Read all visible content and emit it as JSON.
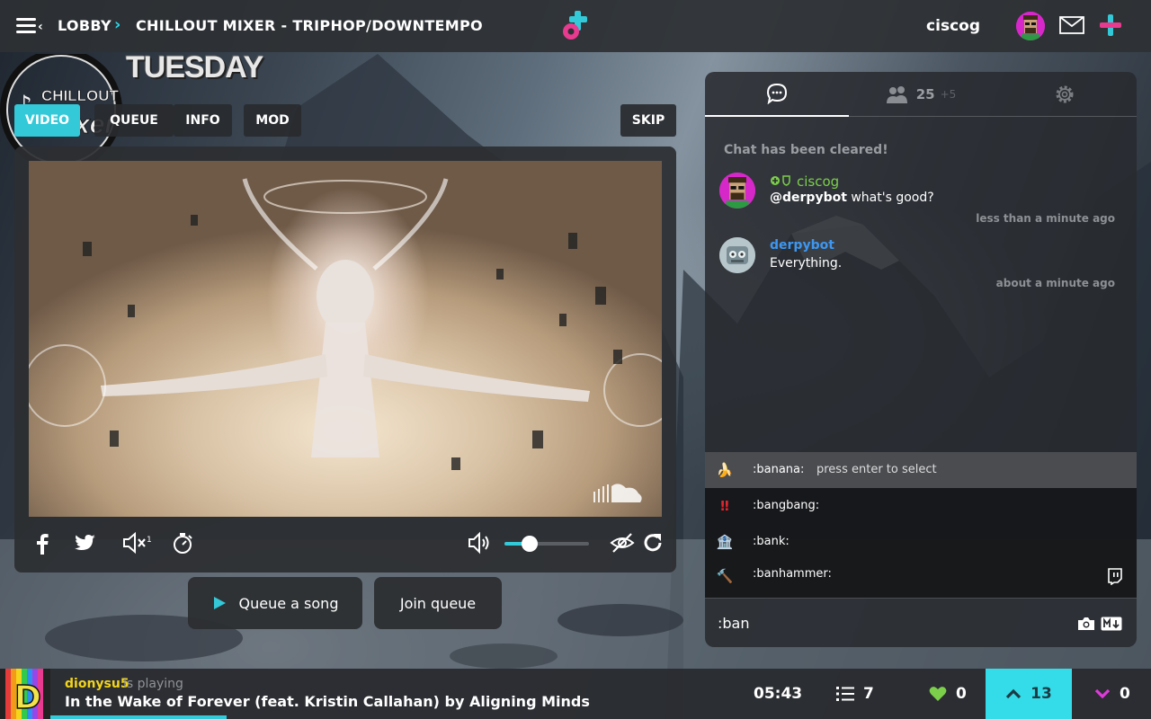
{
  "header": {
    "breadcrumb": [
      "LOBBY",
      "CHILLOUT MIXER - TRIPHOP/DOWNTEMPO"
    ],
    "username": "ciscog"
  },
  "room": {
    "logo_text_top": "CHILLOUT",
    "logo_text_bottom": "mixer",
    "banner": "TUESDAY",
    "tabs": [
      "VIDEO",
      "QUEUE",
      "INFO",
      "MOD"
    ],
    "active_tab": "VIDEO",
    "skip_label": "SKIP"
  },
  "player": {
    "volume": 0.25,
    "icons": [
      "facebook-icon",
      "twitter-icon",
      "mute-icon",
      "timer-icon",
      "volume-icon",
      "hide-video-icon",
      "refresh-icon",
      "soundcloud-icon"
    ]
  },
  "queue_actions": {
    "queue_song": "Queue a song",
    "join_queue": "Join queue"
  },
  "chat": {
    "user_count": "25",
    "guest_count": "+5",
    "cleared_notice": "Chat has been cleared!",
    "messages": [
      {
        "user": "ciscog",
        "mention": "@derpybot",
        "text": " what's good?",
        "time": "less than a minute ago",
        "name_color": "#7ccf4a"
      },
      {
        "user": "derpybot",
        "mention": "",
        "text": "Everything.",
        "time": "about a minute ago",
        "name_color": "#3d97f2"
      }
    ],
    "autocomplete": [
      {
        "emoji": "🍌",
        "code": ":banana:",
        "hint": "press enter to select"
      },
      {
        "emoji": "‼️",
        "code": ":bangbang:",
        "hint": ""
      },
      {
        "emoji": "🏦",
        "code": ":bank:",
        "hint": ""
      },
      {
        "emoji": "🔨",
        "code": ":banhammer:",
        "hint": ""
      }
    ],
    "input_value": ":ban"
  },
  "now_playing": {
    "dj": "dionysu5",
    "status": "is playing",
    "title": "In the Wake of Forever (feat. Kristin Callahan) by Aligning Minds",
    "progress": 0.16,
    "remaining": "05:43",
    "queue_count": "7",
    "hearts": "0",
    "upvotes": "13",
    "downvotes": "0"
  },
  "colors": {
    "accent": "#33c9d8",
    "upvote_bg": "#33dce8",
    "heart": "#7ccf4a",
    "downvote": "#e03adb",
    "dj_name": "#f3d51b"
  }
}
